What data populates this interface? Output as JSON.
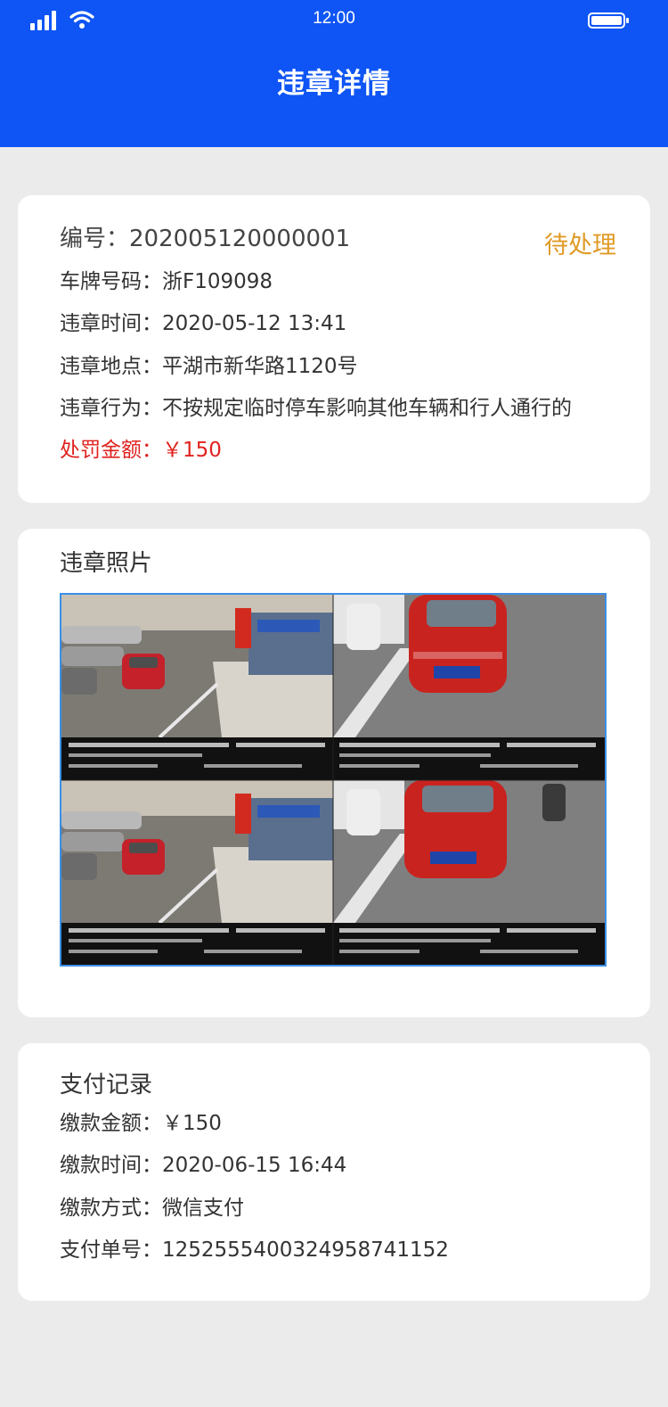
{
  "status_bar": {
    "time": "12:00"
  },
  "header": {
    "title": "违章详情"
  },
  "violation": {
    "number_label": "编号：",
    "number_value": "202005120000001",
    "status": "待处理",
    "plate_label": "车牌号码：",
    "plate_value": "浙F109098",
    "time_label": "违章时间：",
    "time_value": "2020-05-12 13:41",
    "location_label": "违章地点：",
    "location_value": "平湖市新华路1120号",
    "behavior_label": "违章行为：",
    "behavior_value": "不按规定临时停车影响其他车辆和行人通行的",
    "fine_label": "处罚金额：",
    "fine_value": "￥150"
  },
  "photo": {
    "title": "违章照片"
  },
  "payment": {
    "title": "支付记录",
    "amount_label": "缴款金额：",
    "amount_value": "￥150",
    "time_label": "缴款时间：",
    "time_value": "2020-06-15 16:44",
    "method_label": "缴款方式：",
    "method_value": "微信支付",
    "order_label": "支付单号：",
    "order_value": "1252555400324958741152"
  },
  "colors": {
    "header_bg": "#0f55f5",
    "status_pending": "#e09a25",
    "fine_red": "#e0221e",
    "page_bg": "#ebebeb"
  }
}
